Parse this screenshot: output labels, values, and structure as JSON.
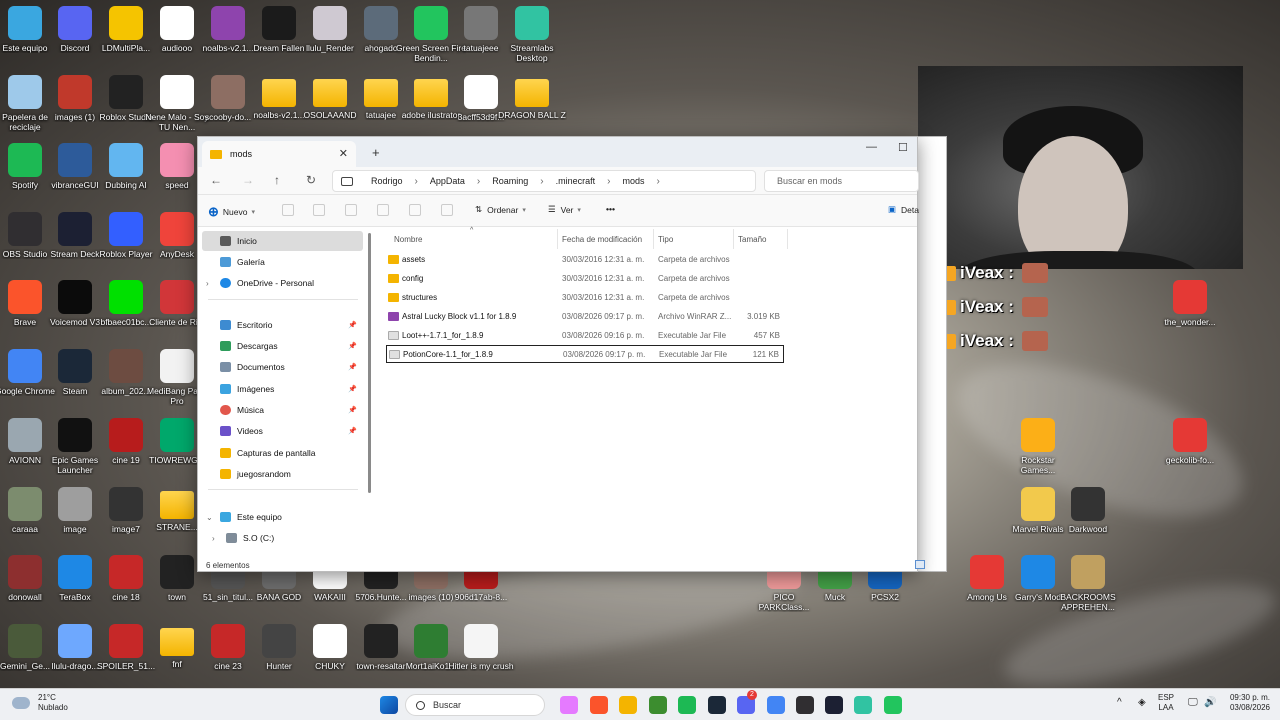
{
  "desktop": {
    "icons": [
      {
        "label": "Este equipo",
        "color": "#3aa7e0"
      },
      {
        "label": "Discord",
        "color": "#5865f2"
      },
      {
        "label": "LDMultiPla...",
        "color": "#f5c400"
      },
      {
        "label": "audiooo",
        "color": "#ffffff"
      },
      {
        "label": "noalbs-v2.1...",
        "color": "#8e44ad"
      },
      {
        "label": "Dream Fallen",
        "color": "#1b1b1b"
      },
      {
        "label": "llulu_Render",
        "color": "#cfc9d2"
      },
      {
        "label": "ahogado",
        "color": "#5c6b7a"
      },
      {
        "label": "Green Screen Fire Bendin...",
        "color": "#22c55e"
      },
      {
        "label": "tatuajeee",
        "color": "#777777"
      },
      {
        "label": "Streamlabs Desktop",
        "color": "#31c3a2"
      },
      {
        "label": "Papelera de reciclaje",
        "color": "#9ec9ea"
      },
      {
        "label": "images (1)",
        "color": "#c0392b"
      },
      {
        "label": "Roblox Studio",
        "color": "#222222"
      },
      {
        "label": "Nene Malo - Soy TU Nen...",
        "color": "#ffffff"
      },
      {
        "label": "scooby-do...",
        "color": "#8d6e63"
      },
      {
        "label": "noalbs-v2.1...",
        "color": "folder"
      },
      {
        "label": "OSOLAAAND",
        "color": "folder"
      },
      {
        "label": "tatuajee",
        "color": "folder"
      },
      {
        "label": "adobe ilustrator",
        "color": "folder"
      },
      {
        "label": "3acff53d9f...",
        "color": "#ffffff"
      },
      {
        "label": "DRAGON BALL Z",
        "color": "folder"
      },
      {
        "label": "Spotify",
        "color": "#1db954"
      },
      {
        "label": "vibranceGUI",
        "color": "#2d5b9a"
      },
      {
        "label": "Dubbing AI",
        "color": "#62b6f0"
      },
      {
        "label": "speed",
        "color": "#f48fb1"
      },
      {
        "label": "OBS Studio",
        "color": "#302e31"
      },
      {
        "label": "Stream Deck",
        "color": "#1c2033"
      },
      {
        "label": "Roblox Player",
        "color": "#335fff"
      },
      {
        "label": "AnyDesk",
        "color": "#ef443b"
      },
      {
        "label": "Brave",
        "color": "#fb542b"
      },
      {
        "label": "Voicemod V3",
        "color": "#0b0b0b"
      },
      {
        "label": "bfbaec01bc...",
        "color": "#00e000"
      },
      {
        "label": "Cliente de Riot",
        "color": "#d13639"
      },
      {
        "label": "Google Chrome",
        "color": "#4285f4"
      },
      {
        "label": "Steam",
        "color": "#1b2838"
      },
      {
        "label": "album_202...",
        "color": "#6d4c41"
      },
      {
        "label": "MediBang Paint Pro",
        "color": "#f2f2f2"
      },
      {
        "label": "AVIONN",
        "color": "#9aa7b0"
      },
      {
        "label": "Epic Games Launcher",
        "color": "#111111"
      },
      {
        "label": "cine 19",
        "color": "#b71c1c"
      },
      {
        "label": "TIOWREWG...",
        "color": "#00a86b"
      },
      {
        "label": "caraaa",
        "color": "#7c8c6e"
      },
      {
        "label": "image",
        "color": "#9e9e9e"
      },
      {
        "label": "image7",
        "color": "#333333"
      },
      {
        "label": "STRANE...",
        "color": "folder"
      },
      {
        "label": "donowall",
        "color": "#8d2f2f"
      },
      {
        "label": "TeraBox",
        "color": "#1e88e5"
      },
      {
        "label": "cine 18",
        "color": "#c62828"
      },
      {
        "label": "town",
        "color": "#222222"
      },
      {
        "label": "51_sin_titul...",
        "color": "#555555"
      },
      {
        "label": "BANA GOD",
        "color": "#6d6d6d"
      },
      {
        "label": "WAKAIII",
        "color": "#ffffff"
      },
      {
        "label": "5706.Hunte...",
        "color": "#222222"
      },
      {
        "label": "images (10)",
        "color": "#8d6e63"
      },
      {
        "label": "906d17ab-8...",
        "color": "#b71c1c"
      },
      {
        "label": "Gemini_Ge...",
        "color": "#4a5a3a"
      },
      {
        "label": "llulu-drago...",
        "color": "#6ea8fe"
      },
      {
        "label": "SPOILER_51...",
        "color": "#c62828"
      },
      {
        "label": "fnf",
        "color": "folder"
      },
      {
        "label": "cine 23",
        "color": "#c62828"
      },
      {
        "label": "Hunter",
        "color": "#444444"
      },
      {
        "label": "CHUKY",
        "color": "#ffffff"
      },
      {
        "label": "town-resaltar",
        "color": "#222222"
      },
      {
        "label": "Mort1aiKo1...",
        "color": "#2e7d32"
      },
      {
        "label": "Hitler is my crush",
        "color": "#f5f5f5"
      },
      {
        "label": "the_wonder...",
        "color": "#e53935"
      },
      {
        "label": "Rockstar Games...",
        "color": "#fcaf17"
      },
      {
        "label": "geckolib-fo...",
        "color": "#e53935"
      },
      {
        "label": "Marvel Rivals",
        "color": "#f2c94c"
      },
      {
        "label": "Darkwood",
        "color": "#333333"
      },
      {
        "label": "PICO PARKClass...",
        "color": "#ef9a9a"
      },
      {
        "label": "Muck",
        "color": "#43a047"
      },
      {
        "label": "PCSX2",
        "color": "#1565c0"
      },
      {
        "label": "Among Us",
        "color": "#e53935"
      },
      {
        "label": "Garry's Mod",
        "color": "#1e88e5"
      },
      {
        "label": "BACKROOMS APPREHEN...",
        "color": "#c0a060"
      }
    ]
  },
  "explorer": {
    "tab_title": "mods",
    "tab_close": "✕",
    "tab_add": "+",
    "win_minimize": "—",
    "win_maximize": "☐",
    "nav": {
      "back": "←",
      "forward": "→",
      "up": "↑",
      "refresh": "↻"
    },
    "breadcrumb": [
      "Rodrigo",
      "AppData",
      "Roaming",
      ".minecraft",
      "mods"
    ],
    "breadcrumb_sep": "›",
    "search_placeholder": "Buscar en mods",
    "toolbar": {
      "new_label": "Nuevo",
      "sort_label": "Ordenar",
      "view_label": "Ver",
      "more_label": "•••",
      "details_label": "Deta"
    },
    "sidebar": {
      "home": "Inicio",
      "gallery": "Galería",
      "onedrive": "OneDrive - Personal",
      "quick": [
        "Escritorio",
        "Descargas",
        "Documentos",
        "Imágenes",
        "Música",
        "Videos"
      ],
      "folders": [
        "Capturas de pantalla",
        "juegosrandom"
      ],
      "this_pc": "Este equipo",
      "drive": "S.O (C:)",
      "pin": "📌"
    },
    "columns": {
      "name": "Nombre",
      "date": "Fecha de modificación",
      "type": "Tipo",
      "size": "Tamaño"
    },
    "files": [
      {
        "name": "assets",
        "date": "30/03/2016 12:31 a. m.",
        "type": "Carpeta de archivos",
        "size": "",
        "kind": "folder"
      },
      {
        "name": "config",
        "date": "30/03/2016 12:31 a. m.",
        "type": "Carpeta de archivos",
        "size": "",
        "kind": "folder"
      },
      {
        "name": "structures",
        "date": "30/03/2016 12:31 a. m.",
        "type": "Carpeta de archivos",
        "size": "",
        "kind": "folder"
      },
      {
        "name": "Astral Lucky Block v1.1 for 1.8.9",
        "date": "03/08/2026 09:17 p. m.",
        "type": "Archivo WinRAR Z...",
        "size": "3.019 KB",
        "kind": "rar"
      },
      {
        "name": "Loot++-1.7.1_for_1.8.9",
        "date": "03/08/2026 09:16 p. m.",
        "type": "Executable Jar File",
        "size": "457 KB",
        "kind": "jar"
      },
      {
        "name": "PotionCore-1.1_for_1.8.9",
        "date": "03/08/2026 09:17 p. m.",
        "type": "Executable Jar File",
        "size": "121 KB",
        "kind": "jar"
      }
    ],
    "status": "6 elementos"
  },
  "overlay": {
    "chat_user": "iVeax :",
    "chat_lines": 3
  },
  "taskbar": {
    "weather_temp": "21°C",
    "weather_desc": "Nublado",
    "search_label": "Buscar",
    "lang_top": "ESP",
    "lang_bottom": "LAA",
    "time": "09:30 p. m.",
    "date": "03/08/2026",
    "apps": [
      "windows-start",
      "search",
      "copilot",
      "brave",
      "file-explorer",
      "minecraft",
      "spotify",
      "steam",
      "discord",
      "chrome",
      "obs",
      "stream-deck",
      "streamlabs",
      "green-app"
    ],
    "tray_chevron": "^",
    "notification_badge": "2"
  }
}
